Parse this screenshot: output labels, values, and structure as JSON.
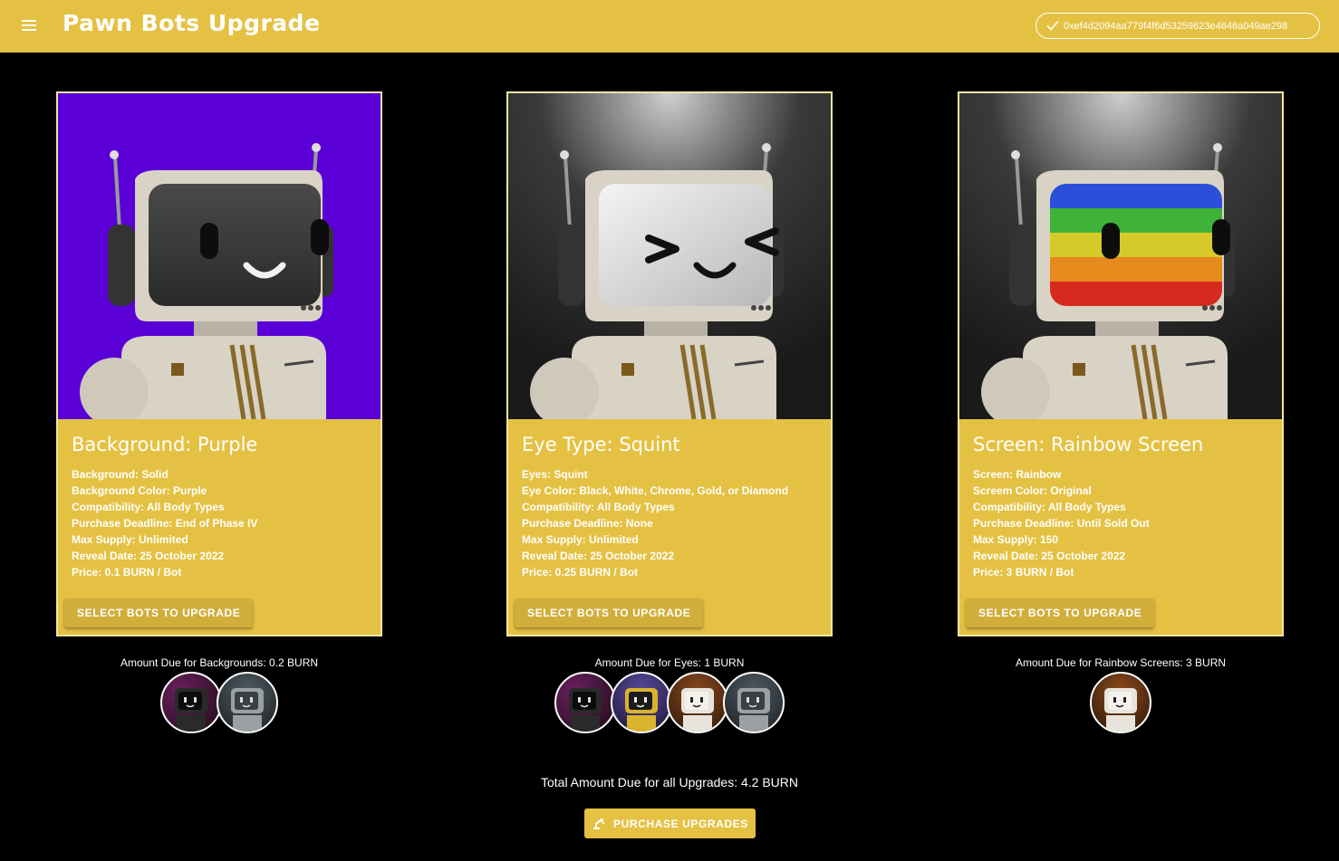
{
  "app": {
    "title": "Pawn Bots Upgrade",
    "wallet_address": "0xef4d2094aa779f4f6d53259623e4646a049ae298"
  },
  "colors": {
    "accent": "#e5c143",
    "background": "#000000"
  },
  "cards": [
    {
      "title": "Background: Purple",
      "image_bg": "#5a00d6",
      "screen": "dark",
      "eyes": "normal",
      "attributes": [
        "Background: Solid",
        "Background Color: Purple",
        "Compatibility: All Body Types",
        "Purchase Deadline: End of Phase IV",
        "Max Supply: Unlimited",
        "Reveal Date: 25 October 2022",
        "Price: 0.1 BURN / Bot"
      ],
      "button_label": "SELECT BOTS TO UPGRADE",
      "amount_due": "Amount Due for Backgrounds: 0.2 BURN",
      "selected_bots": [
        "dark-bot",
        "grey-bot"
      ]
    },
    {
      "title": "Eye Type: Squint",
      "image_bg": "#2b2b2b",
      "screen": "silver",
      "eyes": "squint",
      "attributes": [
        "Eyes: Squint",
        "Eye Color: Black, White, Chrome, Gold, or Diamond",
        "Compatibility: All Body Types",
        "Purchase Deadline: None",
        "Max Supply: Unlimited",
        "Reveal Date: 25 October 2022",
        "Price: 0.25 BURN / Bot"
      ],
      "button_label": "SELECT BOTS TO UPGRADE",
      "amount_due": "Amount Due for Eyes: 1 BURN",
      "selected_bots": [
        "dark-bot",
        "gold-bot",
        "white-bot",
        "grey-bot"
      ]
    },
    {
      "title": "Screen: Rainbow Screen",
      "image_bg": "#2b2b2b",
      "screen": "rainbow",
      "eyes": "normal",
      "attributes": [
        "Screen: Rainbow",
        "Screem Color: Original",
        "Compatibility: All Body Types",
        "Purchase Deadline: Until Sold Out",
        "Max Supply: 150",
        "Reveal Date: 25 October 2022",
        "Price: 3 BURN / Bot"
      ],
      "button_label": "SELECT BOTS TO UPGRADE",
      "amount_due": "Amount Due for Rainbow Screens: 3 BURN",
      "selected_bots": [
        "white-bot"
      ]
    }
  ],
  "total_due": "Total Amount Due for all Upgrades: 4.2 BURN",
  "purchase_label": "PURCHASE UPGRADES"
}
